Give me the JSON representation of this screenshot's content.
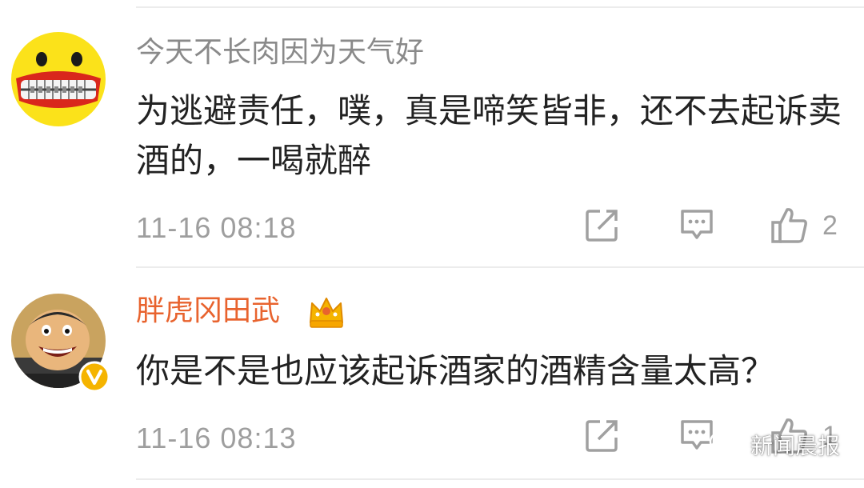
{
  "comments": [
    {
      "username": "今天不长肉因为天气好",
      "text": "为逃避责任，噗，真是啼笑皆非，还不去起诉卖酒的，一喝就醉",
      "timestamp": "11-16 08:18",
      "likes": "2",
      "avatar_icon": "yellow-grin-face-icon"
    },
    {
      "username": "胖虎冈田武",
      "text": "你是不是也应该起诉酒家的酒精含量太高？",
      "timestamp": "11-16 08:13",
      "likes": "1",
      "avatar_icon": "cartoon-character-avatar",
      "badge_icon": "crown-icon",
      "verified_icon": "verified-v-icon"
    }
  ],
  "watermark": "新闻晨报",
  "colors": {
    "username_gray": "#8a8a8a",
    "username_orange": "#e8632e",
    "body_text": "#222222",
    "meta_gray": "#9e9e9e",
    "icon_gray": "#a0a0a0",
    "divider": "#ececec",
    "verified_badge": "#f5b400"
  }
}
